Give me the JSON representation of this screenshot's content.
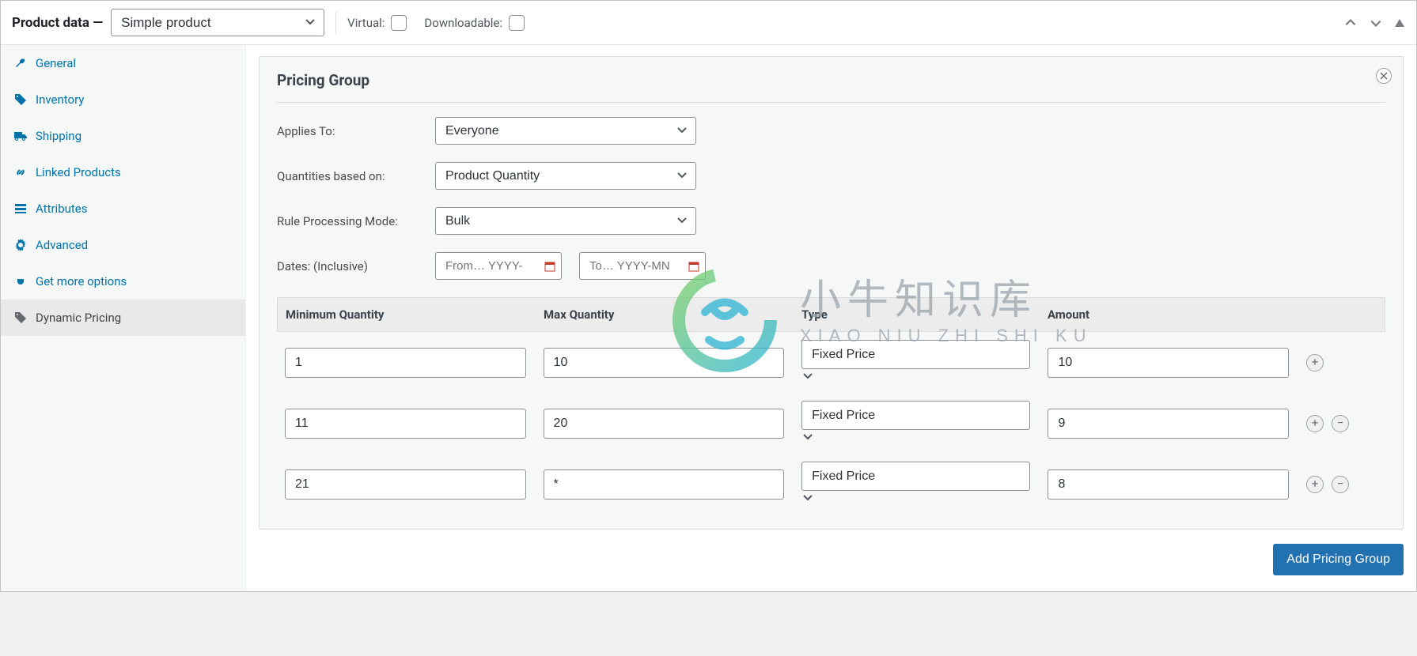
{
  "header": {
    "title": "Product data —",
    "product_type": "Simple product",
    "virtual_label": "Virtual:",
    "downloadable_label": "Downloadable:"
  },
  "sidebar": {
    "items": [
      {
        "label": "General",
        "icon": "wrench"
      },
      {
        "label": "Inventory",
        "icon": "tag"
      },
      {
        "label": "Shipping",
        "icon": "truck"
      },
      {
        "label": "Linked Products",
        "icon": "link"
      },
      {
        "label": "Attributes",
        "icon": "list"
      },
      {
        "label": "Advanced",
        "icon": "gear"
      },
      {
        "label": "Get more options",
        "icon": "plug"
      },
      {
        "label": "Dynamic Pricing",
        "icon": "price-tag",
        "active": true
      }
    ]
  },
  "pricing_group": {
    "title": "Pricing Group",
    "fields": {
      "applies_to": {
        "label": "Applies To:",
        "value": "Everyone"
      },
      "quantities_based_on": {
        "label": "Quantities based on:",
        "value": "Product Quantity"
      },
      "rule_processing_mode": {
        "label": "Rule Processing Mode:",
        "value": "Bulk"
      },
      "dates": {
        "label": "Dates: (Inclusive)",
        "from_placeholder": "From… YYYY-",
        "to_placeholder": "To… YYYY-MN"
      }
    },
    "table": {
      "headers": {
        "min_qty": "Minimum Quantity",
        "max_qty": "Max Quantity",
        "type": "Type",
        "amount": "Amount"
      },
      "rows": [
        {
          "min": "1",
          "max": "10",
          "type": "Fixed Price",
          "amount": "10"
        },
        {
          "min": "11",
          "max": "20",
          "type": "Fixed Price",
          "amount": "9"
        },
        {
          "min": "21",
          "max": "*",
          "type": "Fixed Price",
          "amount": "8"
        }
      ]
    },
    "add_group_button": "Add Pricing Group"
  },
  "watermark": {
    "cn": "小牛知识库",
    "en": "XIAO NIU ZHI SHI KU"
  }
}
